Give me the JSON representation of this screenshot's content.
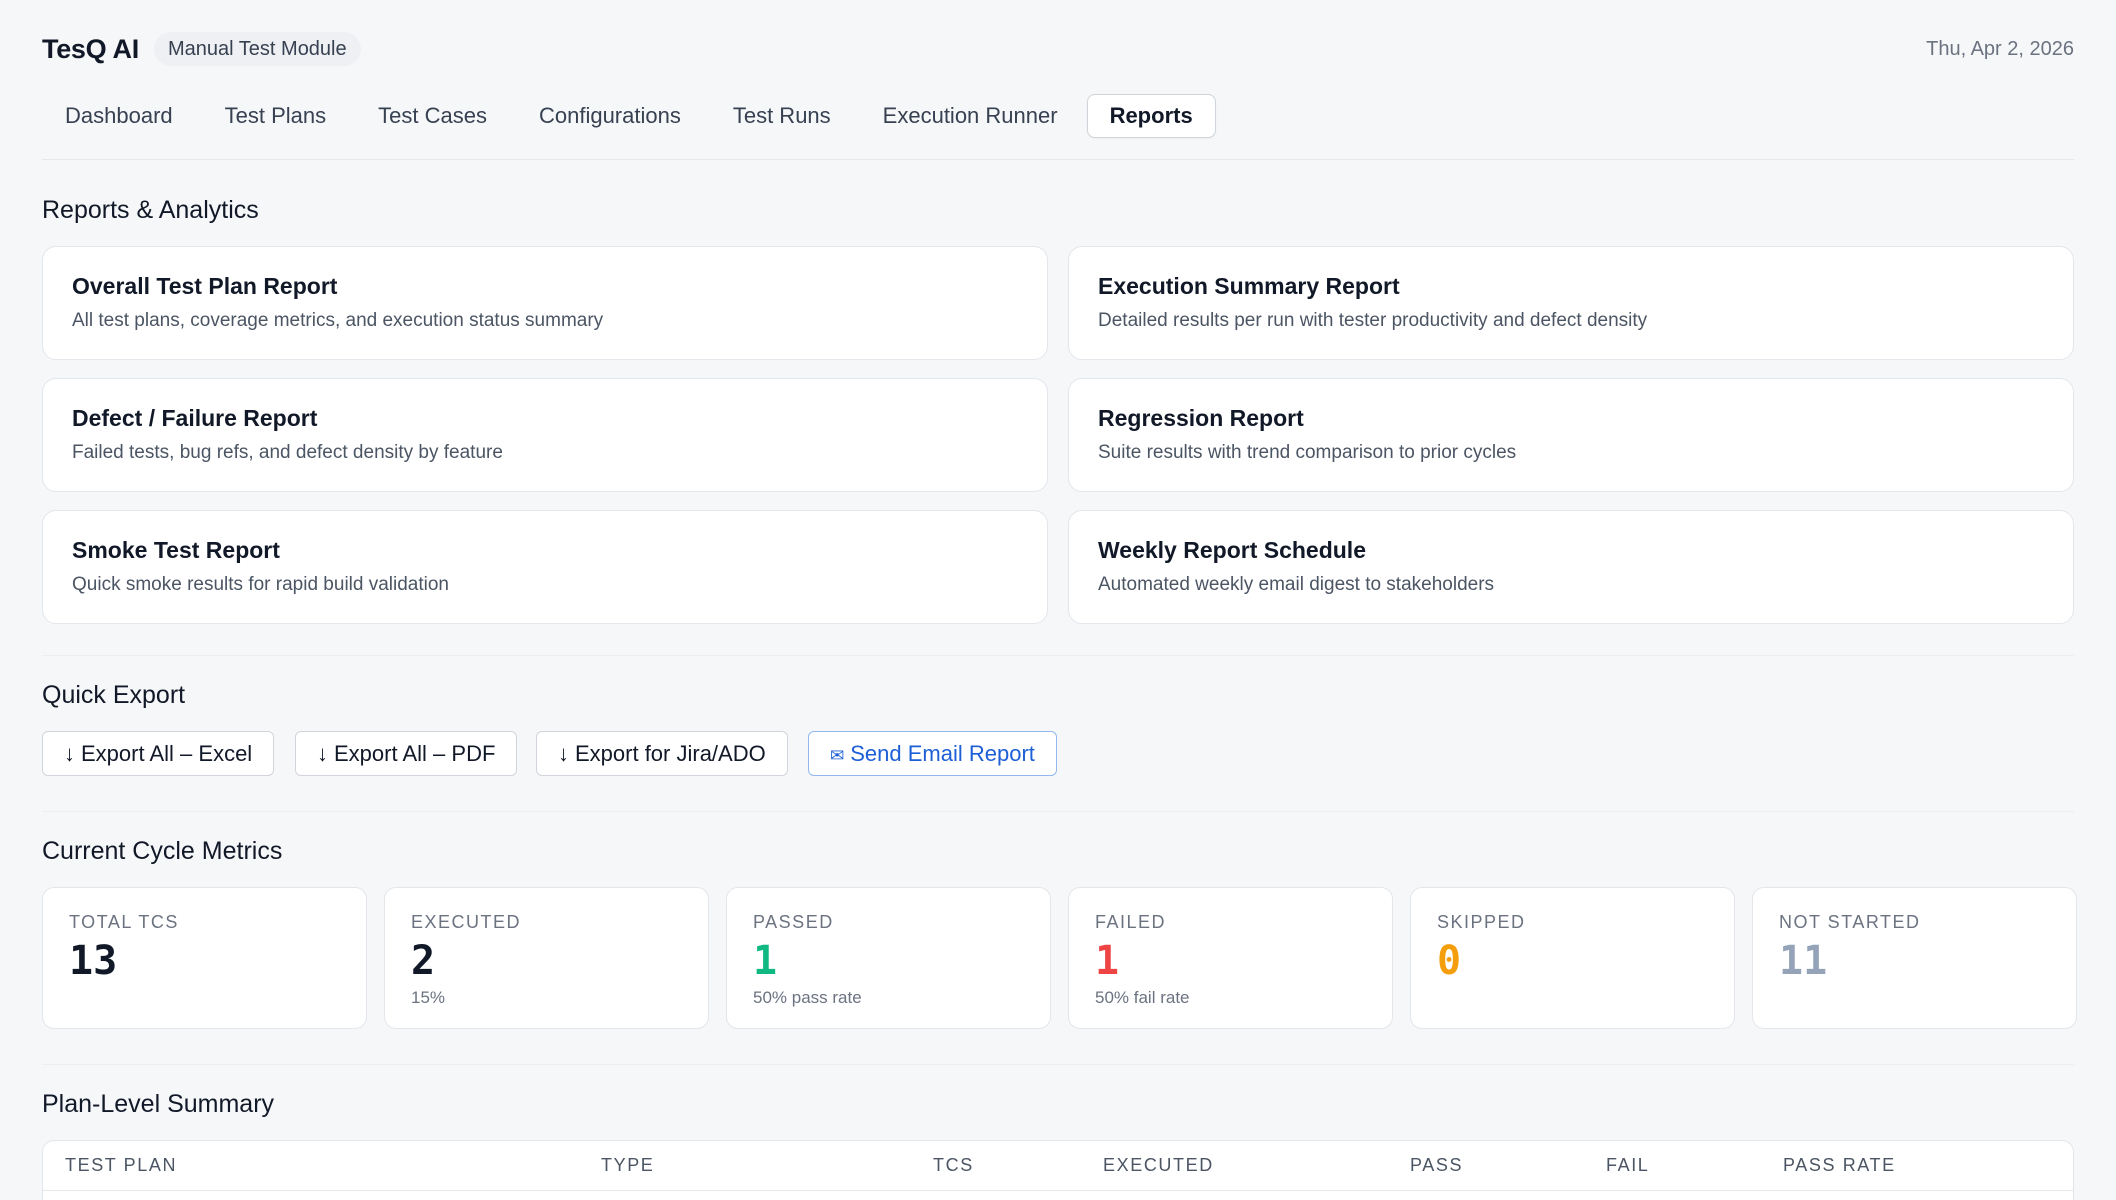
{
  "header": {
    "brand": "TesQ AI",
    "module": "Manual Test Module",
    "date": "Thu, Apr 2, 2026"
  },
  "tabs": [
    {
      "label": "Dashboard",
      "active": false
    },
    {
      "label": "Test Plans",
      "active": false
    },
    {
      "label": "Test Cases",
      "active": false
    },
    {
      "label": "Configurations",
      "active": false
    },
    {
      "label": "Test Runs",
      "active": false
    },
    {
      "label": "Execution Runner",
      "active": false
    },
    {
      "label": "Reports",
      "active": true
    }
  ],
  "reports": {
    "title": "Reports & Analytics",
    "cards": [
      {
        "title": "Overall Test Plan Report",
        "desc": "All test plans, coverage metrics, and execution status summary"
      },
      {
        "title": "Execution Summary Report",
        "desc": "Detailed results per run with tester productivity and defect density"
      },
      {
        "title": "Defect / Failure Report",
        "desc": "Failed tests, bug refs, and defect density by feature"
      },
      {
        "title": "Regression Report",
        "desc": "Suite results with trend comparison to prior cycles"
      },
      {
        "title": "Smoke Test Report",
        "desc": "Quick smoke results for rapid build validation"
      },
      {
        "title": "Weekly Report Schedule",
        "desc": "Automated weekly email digest to stakeholders"
      }
    ]
  },
  "export": {
    "title": "Quick Export",
    "buttons": [
      {
        "icon": "↓",
        "icon_name": "download-icon",
        "label": "Export All – Excel"
      },
      {
        "icon": "↓",
        "icon_name": "download-icon",
        "label": "Export All – PDF"
      },
      {
        "icon": "↓",
        "icon_name": "download-icon",
        "label": "Export for Jira/ADO"
      },
      {
        "icon": "✉",
        "icon_name": "mail-icon",
        "label": "Send Email Report"
      }
    ]
  },
  "metrics": {
    "title": "Current Cycle Metrics",
    "items": [
      {
        "label": "TOTAL TCS",
        "value": "13",
        "sub": "",
        "color": "#111827"
      },
      {
        "label": "EXECUTED",
        "value": "2",
        "sub": "15%",
        "color": "#111827"
      },
      {
        "label": "PASSED",
        "value": "1",
        "sub": "50% pass rate",
        "color": "#10b981"
      },
      {
        "label": "FAILED",
        "value": "1",
        "sub": "50% fail rate",
        "color": "#ef4444"
      },
      {
        "label": "SKIPPED",
        "value": "0",
        "sub": "",
        "color": "#f59e0b"
      },
      {
        "label": "NOT STARTED",
        "value": "11",
        "sub": "",
        "color": "#94a3b8"
      }
    ]
  },
  "plan_summary": {
    "title": "Plan-Level Summary",
    "columns": [
      "TEST PLAN",
      "TYPE",
      "TCS",
      "EXECUTED",
      "PASS",
      "FAIL",
      "PASS RATE"
    ]
  }
}
